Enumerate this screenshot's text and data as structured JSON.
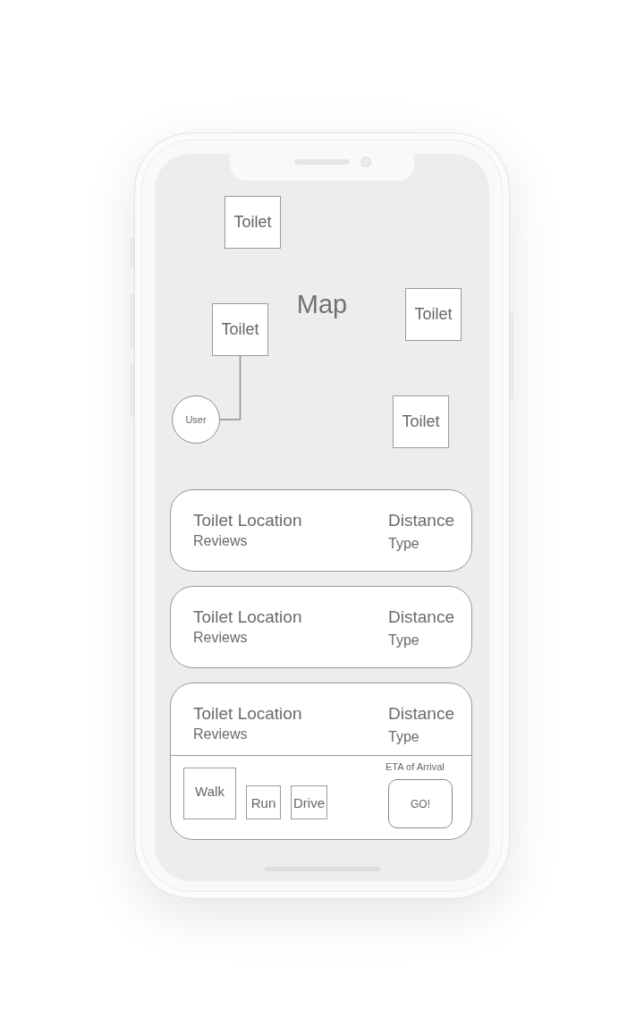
{
  "map": {
    "title": "Map",
    "toilets": [
      {
        "label": "Toilet",
        "connected": false
      },
      {
        "label": "Toilet",
        "connected": true
      },
      {
        "label": "Toilet",
        "connected": false
      },
      {
        "label": "Toilet",
        "connected": false
      }
    ],
    "user": {
      "label": "User"
    }
  },
  "results": [
    {
      "location": "Toilet Location",
      "reviews": "Reviews",
      "distance": "Distance",
      "type": "Type",
      "expanded": false
    },
    {
      "location": "Toilet Location",
      "reviews": "Reviews",
      "distance": "Distance",
      "type": "Type",
      "expanded": false
    },
    {
      "location": "Toilet Location",
      "reviews": "Reviews",
      "distance": "Distance",
      "type": "Type",
      "expanded": true,
      "details": {
        "modes": [
          {
            "label": "Walk",
            "selected": true
          },
          {
            "label": "Run",
            "selected": false
          },
          {
            "label": "Drive",
            "selected": false
          }
        ],
        "eta_label": "ETA of Arrival",
        "go_label": "GO!"
      }
    }
  ]
}
